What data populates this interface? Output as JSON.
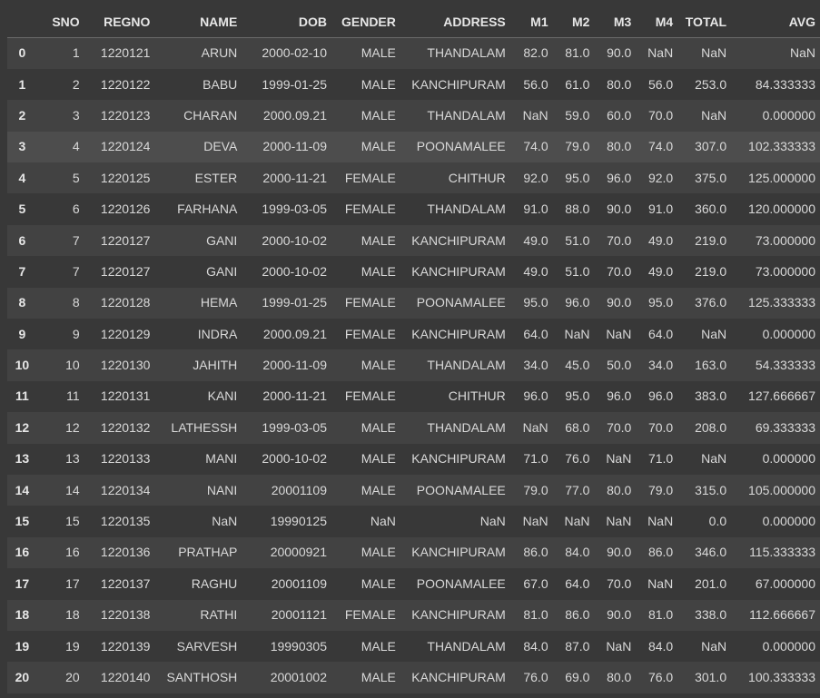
{
  "table": {
    "columns": [
      "SNO",
      "REGNO",
      "NAME",
      "DOB",
      "GENDER",
      "ADDRESS",
      "M1",
      "M2",
      "M3",
      "M4",
      "TOTAL",
      "AVG"
    ],
    "rows": [
      {
        "index": "0",
        "cells": [
          "1",
          "1220121",
          "ARUN",
          "2000-02-10",
          "MALE",
          "THANDALAM",
          "82.0",
          "81.0",
          "90.0",
          "NaN",
          "NaN",
          "NaN"
        ]
      },
      {
        "index": "1",
        "cells": [
          "2",
          "1220122",
          "BABU",
          "1999-01-25",
          "MALE",
          "KANCHIPURAM",
          "56.0",
          "61.0",
          "80.0",
          "56.0",
          "253.0",
          "84.333333"
        ]
      },
      {
        "index": "2",
        "cells": [
          "3",
          "1220123",
          "CHARAN",
          "2000.09.21",
          "MALE",
          "THANDALAM",
          "NaN",
          "59.0",
          "60.0",
          "70.0",
          "NaN",
          "0.000000"
        ]
      },
      {
        "index": "3",
        "cells": [
          "4",
          "1220124",
          "DEVA",
          "2000-11-09",
          "MALE",
          "POONAMALEE",
          "74.0",
          "79.0",
          "80.0",
          "74.0",
          "307.0",
          "102.333333"
        ]
      },
      {
        "index": "4",
        "cells": [
          "5",
          "1220125",
          "ESTER",
          "2000-11-21",
          "FEMALE",
          "CHITHUR",
          "92.0",
          "95.0",
          "96.0",
          "92.0",
          "375.0",
          "125.000000"
        ]
      },
      {
        "index": "5",
        "cells": [
          "6",
          "1220126",
          "FARHANA",
          "1999-03-05",
          "FEMALE",
          "THANDALAM",
          "91.0",
          "88.0",
          "90.0",
          "91.0",
          "360.0",
          "120.000000"
        ]
      },
      {
        "index": "6",
        "cells": [
          "7",
          "1220127",
          "GANI",
          "2000-10-02",
          "MALE",
          "KANCHIPURAM",
          "49.0",
          "51.0",
          "70.0",
          "49.0",
          "219.0",
          "73.000000"
        ]
      },
      {
        "index": "7",
        "cells": [
          "7",
          "1220127",
          "GANI",
          "2000-10-02",
          "MALE",
          "KANCHIPURAM",
          "49.0",
          "51.0",
          "70.0",
          "49.0",
          "219.0",
          "73.000000"
        ]
      },
      {
        "index": "8",
        "cells": [
          "8",
          "1220128",
          "HEMA",
          "1999-01-25",
          "FEMALE",
          "POONAMALEE",
          "95.0",
          "96.0",
          "90.0",
          "95.0",
          "376.0",
          "125.333333"
        ]
      },
      {
        "index": "9",
        "cells": [
          "9",
          "1220129",
          "INDRA",
          "2000.09.21",
          "FEMALE",
          "KANCHIPURAM",
          "64.0",
          "NaN",
          "NaN",
          "64.0",
          "NaN",
          "0.000000"
        ]
      },
      {
        "index": "10",
        "cells": [
          "10",
          "1220130",
          "JAHITH",
          "2000-11-09",
          "MALE",
          "THANDALAM",
          "34.0",
          "45.0",
          "50.0",
          "34.0",
          "163.0",
          "54.333333"
        ]
      },
      {
        "index": "11",
        "cells": [
          "11",
          "1220131",
          "KANI",
          "2000-11-21",
          "FEMALE",
          "CHITHUR",
          "96.0",
          "95.0",
          "96.0",
          "96.0",
          "383.0",
          "127.666667"
        ]
      },
      {
        "index": "12",
        "cells": [
          "12",
          "1220132",
          "LATHESSH",
          "1999-03-05",
          "MALE",
          "THANDALAM",
          "NaN",
          "68.0",
          "70.0",
          "70.0",
          "208.0",
          "69.333333"
        ]
      },
      {
        "index": "13",
        "cells": [
          "13",
          "1220133",
          "MANI",
          "2000-10-02",
          "MALE",
          "KANCHIPURAM",
          "71.0",
          "76.0",
          "NaN",
          "71.0",
          "NaN",
          "0.000000"
        ]
      },
      {
        "index": "14",
        "cells": [
          "14",
          "1220134",
          "NANI",
          "20001109",
          "MALE",
          "POONAMALEE",
          "79.0",
          "77.0",
          "80.0",
          "79.0",
          "315.0",
          "105.000000"
        ]
      },
      {
        "index": "15",
        "cells": [
          "15",
          "1220135",
          "NaN",
          "19990125",
          "NaN",
          "NaN",
          "NaN",
          "NaN",
          "NaN",
          "NaN",
          "0.0",
          "0.000000"
        ]
      },
      {
        "index": "16",
        "cells": [
          "16",
          "1220136",
          "PRATHAP",
          "20000921",
          "MALE",
          "KANCHIPURAM",
          "86.0",
          "84.0",
          "90.0",
          "86.0",
          "346.0",
          "115.333333"
        ]
      },
      {
        "index": "17",
        "cells": [
          "17",
          "1220137",
          "RAGHU",
          "20001109",
          "MALE",
          "POONAMALEE",
          "67.0",
          "64.0",
          "70.0",
          "NaN",
          "201.0",
          "67.000000"
        ]
      },
      {
        "index": "18",
        "cells": [
          "18",
          "1220138",
          "RATHI",
          "20001121",
          "FEMALE",
          "KANCHIPURAM",
          "81.0",
          "86.0",
          "90.0",
          "81.0",
          "338.0",
          "112.666667"
        ]
      },
      {
        "index": "19",
        "cells": [
          "19",
          "1220139",
          "SARVESH",
          "19990305",
          "MALE",
          "THANDALAM",
          "84.0",
          "87.0",
          "NaN",
          "84.0",
          "NaN",
          "0.000000"
        ]
      },
      {
        "index": "20",
        "cells": [
          "20",
          "1220140",
          "SANTHOSH",
          "20001002",
          "MALE",
          "KANCHIPURAM",
          "76.0",
          "69.0",
          "80.0",
          "76.0",
          "301.0",
          "100.333333"
        ]
      }
    ],
    "hover_row": 3
  },
  "colors": {
    "background": "#383838",
    "row_stripe": "#424242",
    "row_hover": "#4d4d4d",
    "text": "#d9d9d9",
    "header_text": "#e6e6e6"
  }
}
